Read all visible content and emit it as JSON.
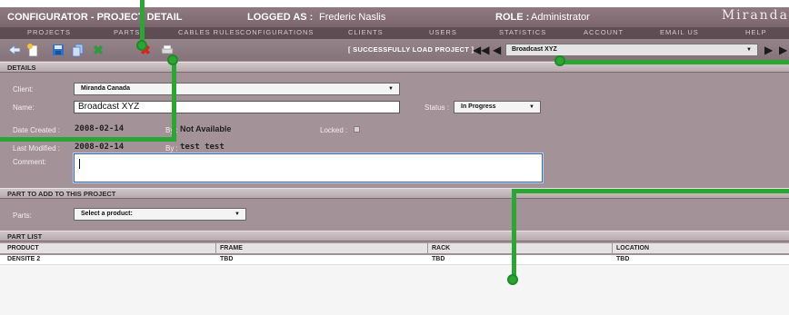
{
  "header": {
    "app_title": "CONFIGURATOR - PROJECT DETAIL",
    "logged_label": "LOGGED AS :",
    "logged_user": "Frederic Naslis",
    "role_label": "ROLE :",
    "role_value": "Administrator",
    "brand": "Miranda"
  },
  "menu": [
    "PROJECTS",
    "PARTS",
    "CABLES RULES",
    "CONFIGURATIONS",
    "CLIENTS",
    "USERS",
    "STATISTICS",
    "ACCOUNT",
    "EMAIL US",
    "HELP"
  ],
  "toolbar": {
    "status_message": "[ SUCCESSFULLY LOAD PROJECT ]",
    "project_selected": "Broadcast XYZ",
    "icons": [
      "back-arrow-icon",
      "new-document-icon",
      "save-disk-icon",
      "copy-icon",
      "excel-export-icon",
      "delete-x-icon",
      "print-icon"
    ]
  },
  "details": {
    "section_title": "DETAILS",
    "client_label": "Client:",
    "client_value": "Miranda Canada",
    "name_label": "Name:",
    "name_value": "Broadcast XYZ",
    "status_label": "Status :",
    "status_value": "In Progress",
    "date_created_label": "Date Created :",
    "date_created_value": "2008-02-14",
    "by_label": "By :",
    "created_by": "Not Available",
    "locked_label": "Locked :",
    "last_modified_label": "Last Modified :",
    "last_modified_value": "2008-02-14",
    "modified_by": "test test",
    "comment_label": "Comment:",
    "comment_value": ""
  },
  "parts_section": {
    "section_title": "PART TO ADD TO THIS PROJECT",
    "parts_label": "Parts:",
    "parts_select": "Select a product:"
  },
  "part_list": {
    "section_title": "PART LIST",
    "columns": [
      "PRODUCT",
      "FRAME",
      "RACK",
      "LOCATION"
    ],
    "rows": [
      [
        "DENSITE 2",
        "TBD",
        "TBD",
        "TBD"
      ]
    ]
  },
  "colors": {
    "panel": "#a39297",
    "menubar": "#5e4e53",
    "callout": "#2aa632"
  }
}
